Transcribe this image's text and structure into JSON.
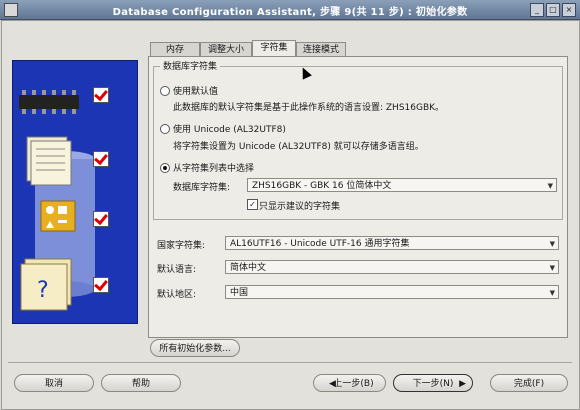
{
  "window": {
    "title": "Database Configuration Assistant, 步骤 9(共 11 步) : 初始化参数"
  },
  "tabs": [
    {
      "label": "内存"
    },
    {
      "label": "调整大小"
    },
    {
      "label": "字符集"
    },
    {
      "label": "连接模式"
    }
  ],
  "charset_group": {
    "label": "数据库字符集",
    "opt_default": "使用默认值",
    "opt_default_desc": "此数据库的默认字符集是基于此操作系统的语言设置: ZHS16GBK。",
    "opt_unicode": "使用 Unicode (AL32UTF8)",
    "opt_unicode_desc": "将字符集设置为 Unicode (AL32UTF8) 就可以存储多语言组。",
    "opt_list": "从字符集列表中选择",
    "db_charset_label": "数据库字符集:",
    "db_charset_value": "ZHS16GBK - GBK 16 位简体中文",
    "show_recommended": "只显示建议的字符集"
  },
  "national_charset": {
    "label": "国家字符集:",
    "value": "AL16UTF16 - Unicode UTF-16 通用字符集"
  },
  "default_language": {
    "label": "默认语言:",
    "value": "简体中文"
  },
  "default_territory": {
    "label": "默认地区:",
    "value": "中国"
  },
  "all_params_button": "所有初始化参数...",
  "buttons": {
    "cancel": "取消",
    "help": "帮助",
    "back": "上一步(B)",
    "next": "下一步(N)",
    "finish": "完成(F)"
  },
  "colors": {
    "side_panel": "#1c35b5",
    "title_bar": "#6b82a0",
    "check_mark": "#dd0000"
  }
}
